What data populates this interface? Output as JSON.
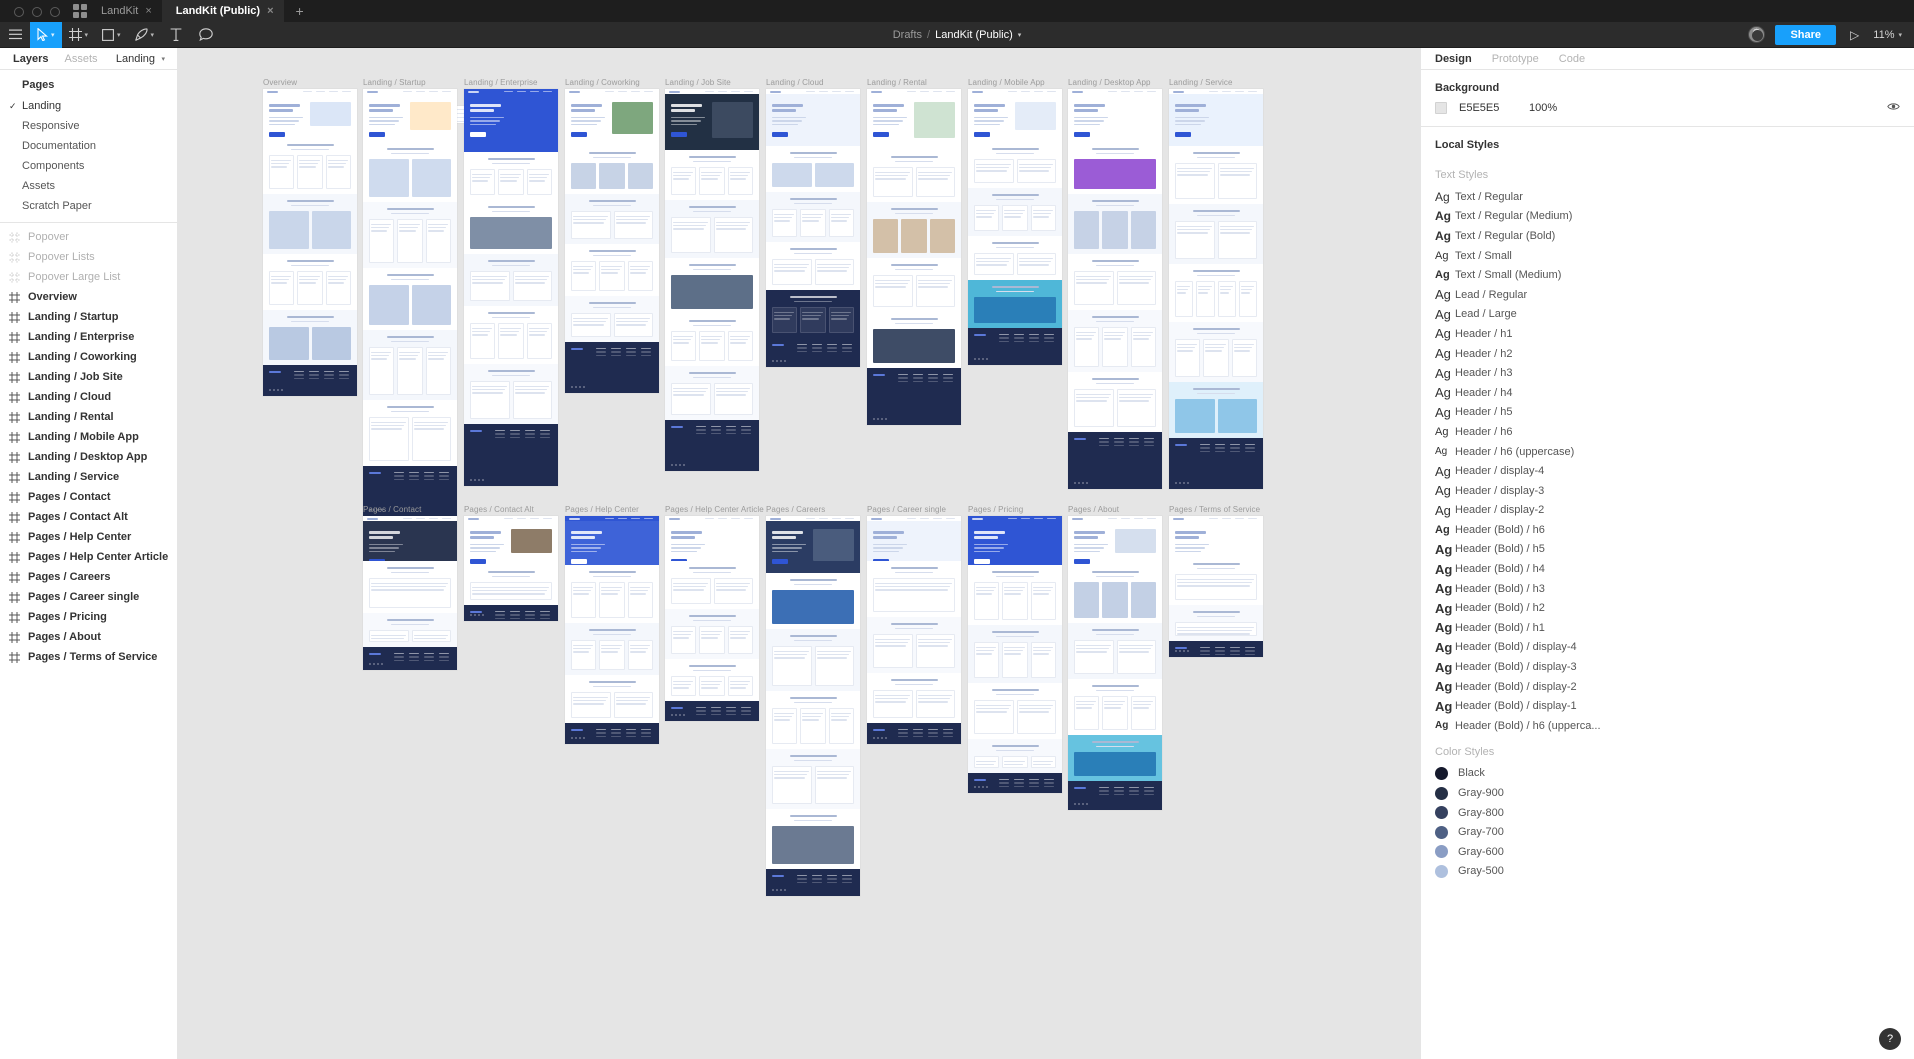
{
  "window": {
    "tabs": [
      {
        "label": "LandKit",
        "active": false
      },
      {
        "label": "LandKit (Public)",
        "active": true
      }
    ],
    "new_tab_label": "+",
    "close_glyph": "×"
  },
  "toolbar": {
    "menu_icon": "hamburger-icon",
    "tools": [
      {
        "name": "move-tool",
        "glyph": "▷",
        "caret": "▾",
        "active": true
      },
      {
        "name": "frame-tool",
        "glyph": "#",
        "caret": "▾",
        "active": false
      },
      {
        "name": "shape-tool",
        "glyph": "□",
        "caret": "▾",
        "active": false
      },
      {
        "name": "pen-tool",
        "glyph": "✒",
        "caret": "▾",
        "active": false
      },
      {
        "name": "text-tool",
        "glyph": "T",
        "caret": "",
        "active": false
      },
      {
        "name": "comment-tool",
        "glyph": "◯",
        "caret": "",
        "active": false
      }
    ],
    "breadcrumb": {
      "project": "Drafts",
      "separator": "/",
      "file": "LandKit (Public)",
      "caret": "▾"
    },
    "share_label": "Share",
    "present_glyph": "▷",
    "zoom_level": "11%",
    "zoom_caret": "▾"
  },
  "left_panel": {
    "tabs": [
      {
        "label": "Layers",
        "active": true
      },
      {
        "label": "Assets",
        "active": false
      }
    ],
    "current_page": "Landing",
    "current_page_caret": "▾",
    "pages_header": "Pages",
    "pages": [
      {
        "label": "Landing",
        "selected": true
      },
      {
        "label": "Responsive",
        "selected": false
      },
      {
        "label": "Documentation",
        "selected": false
      },
      {
        "label": "Components",
        "selected": false
      },
      {
        "label": "Assets",
        "selected": false
      },
      {
        "label": "Scratch Paper",
        "selected": false
      }
    ],
    "check_glyph": "✓",
    "layers": [
      {
        "label": "Popover",
        "type": "component",
        "dim": true
      },
      {
        "label": "Popover Lists",
        "type": "component",
        "dim": true
      },
      {
        "label": "Popover Large List",
        "type": "component",
        "dim": true
      },
      {
        "label": "Overview",
        "type": "frame",
        "dim": false
      },
      {
        "label": "Landing / Startup",
        "type": "frame",
        "dim": false
      },
      {
        "label": "Landing / Enterprise",
        "type": "frame",
        "dim": false
      },
      {
        "label": "Landing / Coworking",
        "type": "frame",
        "dim": false
      },
      {
        "label": "Landing / Job Site",
        "type": "frame",
        "dim": false
      },
      {
        "label": "Landing / Cloud",
        "type": "frame",
        "dim": false
      },
      {
        "label": "Landing / Rental",
        "type": "frame",
        "dim": false
      },
      {
        "label": "Landing / Mobile App",
        "type": "frame",
        "dim": false
      },
      {
        "label": "Landing / Desktop App",
        "type": "frame",
        "dim": false
      },
      {
        "label": "Landing / Service",
        "type": "frame",
        "dim": false
      },
      {
        "label": "Pages / Contact",
        "type": "frame",
        "dim": false
      },
      {
        "label": "Pages / Contact Alt",
        "type": "frame",
        "dim": false
      },
      {
        "label": "Pages / Help Center",
        "type": "frame",
        "dim": false
      },
      {
        "label": "Pages / Help Center Article",
        "type": "frame",
        "dim": false
      },
      {
        "label": "Pages / Careers",
        "type": "frame",
        "dim": false
      },
      {
        "label": "Pages / Career single",
        "type": "frame",
        "dim": false
      },
      {
        "label": "Pages / Pricing",
        "type": "frame",
        "dim": false
      },
      {
        "label": "Pages / About",
        "type": "frame",
        "dim": false
      },
      {
        "label": "Pages / Terms of Service",
        "type": "frame",
        "dim": false
      }
    ]
  },
  "canvas": {
    "background_color": "#E5E5E5",
    "frame_labels_row1": [
      "Overview",
      "Landing / Startup",
      "Landing / Enterprise",
      "Landing / Coworking",
      "Landing / Job Site",
      "Landing / Cloud",
      "Landing / Rental",
      "Landing / Mobile App",
      "Landing / Desktop App",
      "Landing / Service"
    ],
    "frame_labels_row2": [
      "Pages / Contact",
      "Pages / Contact Alt",
      "Pages / Help Center",
      "Pages / Help Center Article",
      "Pages / Careers",
      "Pages / Career single",
      "Pages / Pricing",
      "Pages / About",
      "Pages / Terms of Service"
    ]
  },
  "right_panel": {
    "tabs": [
      {
        "label": "Design",
        "active": true
      },
      {
        "label": "Prototype",
        "active": false
      },
      {
        "label": "Code",
        "active": false
      }
    ],
    "background": {
      "title": "Background",
      "hex": "E5E5E5",
      "opacity": "100%",
      "visibility_icon": "eye-icon"
    },
    "local_styles_title": "Local Styles",
    "text_styles_label": "Text Styles",
    "sample_glyph": "Ag",
    "text_styles": [
      {
        "name": "Text / Regular",
        "weight": 400,
        "size": 12
      },
      {
        "name": "Text / Regular (Medium)",
        "weight": 600,
        "size": 12
      },
      {
        "name": "Text / Regular (Bold)",
        "weight": 700,
        "size": 12
      },
      {
        "name": "Text / Small",
        "weight": 400,
        "size": 11
      },
      {
        "name": "Text / Small (Medium)",
        "weight": 600,
        "size": 11
      },
      {
        "name": "Lead / Regular",
        "weight": 400,
        "size": 13
      },
      {
        "name": "Lead / Large",
        "weight": 400,
        "size": 13
      },
      {
        "name": "Header / h1",
        "weight": 400,
        "size": 13
      },
      {
        "name": "Header / h2",
        "weight": 400,
        "size": 13
      },
      {
        "name": "Header / h3",
        "weight": 400,
        "size": 13
      },
      {
        "name": "Header / h4",
        "weight": 400,
        "size": 13
      },
      {
        "name": "Header / h5",
        "weight": 400,
        "size": 13
      },
      {
        "name": "Header / h6",
        "weight": 400,
        "size": 11
      },
      {
        "name": "Header / h6 (uppercase)",
        "weight": 400,
        "size": 10
      },
      {
        "name": "Header / display-4",
        "weight": 400,
        "size": 13
      },
      {
        "name": "Header / display-3",
        "weight": 400,
        "size": 13
      },
      {
        "name": "Header / display-2",
        "weight": 400,
        "size": 13
      },
      {
        "name": "Header (Bold) / h6",
        "weight": 700,
        "size": 11
      },
      {
        "name": "Header (Bold) / h5",
        "weight": 700,
        "size": 13
      },
      {
        "name": "Header (Bold) / h4",
        "weight": 700,
        "size": 13
      },
      {
        "name": "Header (Bold) / h3",
        "weight": 700,
        "size": 13
      },
      {
        "name": "Header (Bold) / h2",
        "weight": 700,
        "size": 13
      },
      {
        "name": "Header (Bold) / h1",
        "weight": 700,
        "size": 13
      },
      {
        "name": "Header (Bold) / display-4",
        "weight": 700,
        "size": 13
      },
      {
        "name": "Header (Bold) / display-3",
        "weight": 700,
        "size": 13
      },
      {
        "name": "Header (Bold) / display-2",
        "weight": 700,
        "size": 13
      },
      {
        "name": "Header (Bold) / display-1",
        "weight": 700,
        "size": 13
      },
      {
        "name": "Header (Bold) / h6 (upperca...",
        "weight": 700,
        "size": 10
      }
    ],
    "color_styles_label": "Color Styles",
    "color_styles": [
      {
        "name": "Black",
        "hex": "#15192C"
      },
      {
        "name": "Gray-900",
        "hex": "#252F45"
      },
      {
        "name": "Gray-800",
        "hex": "#35415F"
      },
      {
        "name": "Gray-700",
        "hex": "#4E6084"
      },
      {
        "name": "Gray-600",
        "hex": "#8A9DC4"
      },
      {
        "name": "Gray-500",
        "hex": "#AEC0DE"
      }
    ],
    "help_label": "?"
  }
}
